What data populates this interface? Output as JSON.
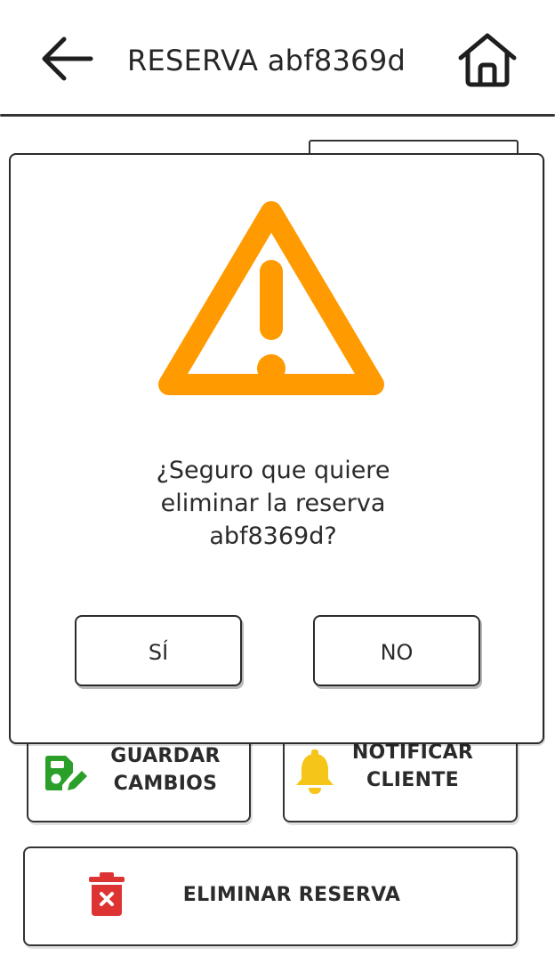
{
  "header": {
    "title": "RESERVA abf8369d",
    "back_icon": "arrow-left-icon",
    "home_icon": "home-icon"
  },
  "actions": {
    "save": {
      "line1": "GUARDAR",
      "line2": "CAMBIOS",
      "icon": "save-edit-icon",
      "icon_color": "#2aa02a"
    },
    "notify": {
      "line1": "NOTIFICAR",
      "line2": "CLIENTE",
      "icon": "bell-icon",
      "icon_color": "#f5c518"
    },
    "delete": {
      "label": "ELIMINAR RESERVA",
      "icon": "trash-icon",
      "icon_color": "#dd3333"
    }
  },
  "modal": {
    "icon": "warning-icon",
    "icon_color": "#ff9a00",
    "message_lines": [
      "¿Seguro que quiere",
      "eliminar la reserva",
      "abf8369d?"
    ],
    "yes_label": "SÍ",
    "no_label": "NO"
  }
}
